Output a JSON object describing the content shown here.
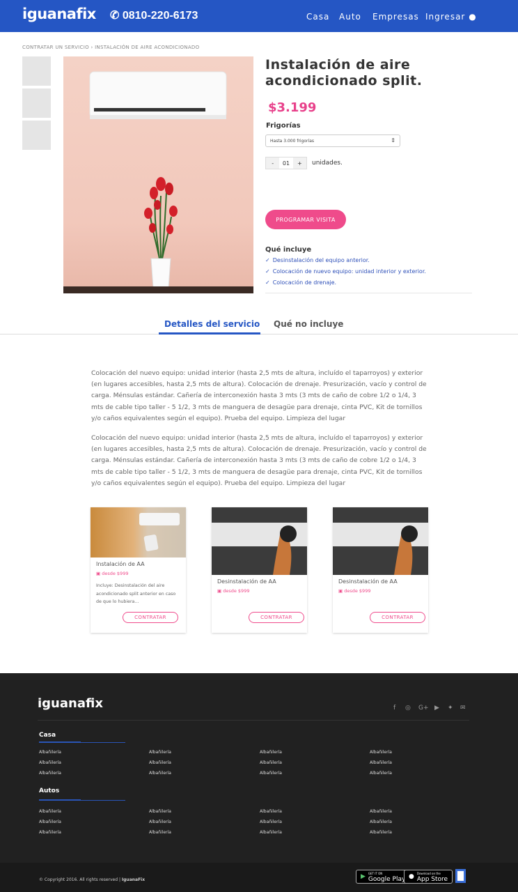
{
  "header": {
    "logo": "iguanafix",
    "phone": "0810-220-6173",
    "nav": [
      "Casa",
      "Auto",
      "Empresas",
      "Ingresar"
    ]
  },
  "breadcrumb": {
    "items": [
      "CONTRATAR UN SERVICIO",
      "INSTALACIÓN DE AIRE ACONDICIONADO"
    ]
  },
  "product": {
    "title": "Instalación de aire acondicionado split.",
    "price": "$3.199",
    "frigorias_label": "Frigorías",
    "frigorias_value": "Hasta 3.000 frigorías",
    "quantity": "01",
    "units_label": "unidades.",
    "cta": "PROGRAMAR VISITA",
    "includes_title": "Qué incluye",
    "includes": [
      "Desinstalación del equipo anterior.",
      "Colocación de nuevo equipo: unidad interior y exterior.",
      "Colocación de drenaje."
    ]
  },
  "tabs": [
    "Detalles del servicio",
    "Qué no incluye"
  ],
  "details": [
    "Colocación del nuevo equipo: unidad interior (hasta 2,5 mts de altura, incluído el taparroyos) y exterior (en lugares accesibles, hasta 2,5 mts de altura). Colocación de drenaje. Presurización, vacío y control de carga. Ménsulas estándar. Cañería de interconexión hasta 3 mts (3 mts de caño de cobre 1/2 o 1/4, 3 mts de cable tipo taller - 5 1/2, 3 mts de manguera de desagüe para drenaje, cinta PVC, Kit de tornillos y/o caños equivalentes según el equipo). Prueba del equipo. Limpieza del lugar",
    "Colocación del nuevo equipo: unidad interior (hasta 2,5 mts de altura, incluído el taparroyos) y exterior (en lugares accesibles, hasta 2,5 mts de altura). Colocación de drenaje. Presurización, vacío y control de carga. Ménsulas estándar. Cañería de interconexión hasta 3 mts (3 mts de caño de cobre 1/2 o 1/4, 3 mts de cable tipo taller - 5 1/2, 3 mts de manguera de desagüe para drenaje, cinta PVC, Kit de tornillos y/o caños equivalentes según el equipo). Prueba del equipo. Limpieza del lugar"
  ],
  "cards": [
    {
      "title": "Instalación de AA",
      "price": "desde $999",
      "desc": "Incluye: Desinstalación del aire acondicionado split anterior en caso de que lo hubiera...",
      "cta": "CONTRATAR"
    },
    {
      "title": "Desinstalación de AA",
      "price": "desde $999",
      "desc": "",
      "cta": "CONTRATAR"
    },
    {
      "title": "Desinstalación de AA",
      "price": "desde $999",
      "desc": "",
      "cta": "CONTRATAR"
    }
  ],
  "footer": {
    "logo": "iguanafix",
    "social_icons": [
      "facebook-icon",
      "instagram-icon",
      "google-plus-icon",
      "youtube-icon",
      "twitter-icon",
      "mail-icon"
    ],
    "sections": [
      {
        "title": "Casa",
        "link": "Albañilería"
      },
      {
        "title": "Autos",
        "link": "Albañilería"
      }
    ],
    "copyright": "© Copyright 2016. All rights reserved |",
    "copyright_brand": "IguanaFix",
    "google_play_small": "GET IT ON",
    "google_play": "Google Play",
    "app_store_small": "Download on the",
    "app_store": "App Store"
  },
  "colors": {
    "brand_blue": "#2556c4",
    "accent_pink": "#ef4b8b",
    "footer_bg": "#212121"
  }
}
